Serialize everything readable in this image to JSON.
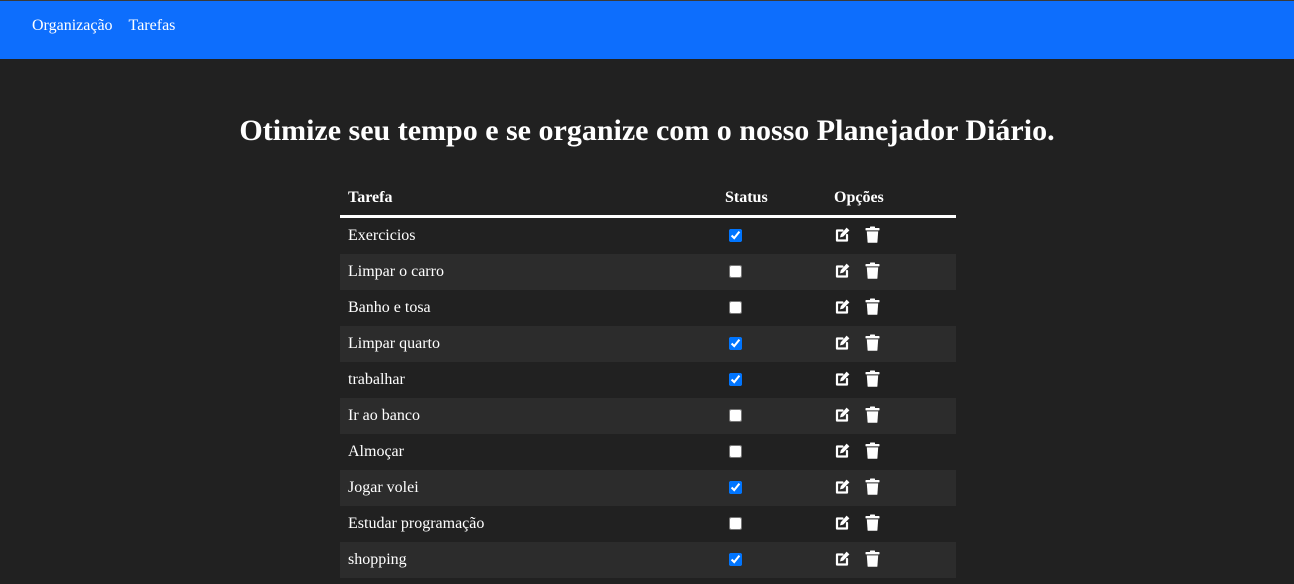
{
  "nav": {
    "items": [
      {
        "label": "Organização"
      },
      {
        "label": "Tarefas"
      }
    ]
  },
  "headline": "Otimize seu tempo e se organize com o nosso Planejador Diário.",
  "table": {
    "headers": {
      "task": "Tarefa",
      "status": "Status",
      "options": "Opções"
    },
    "rows": [
      {
        "task": "Exercicios",
        "done": true
      },
      {
        "task": "Limpar o carro",
        "done": false
      },
      {
        "task": "Banho e tosa",
        "done": false
      },
      {
        "task": "Limpar quarto",
        "done": true
      },
      {
        "task": "trabalhar",
        "done": true
      },
      {
        "task": "Ir ao banco",
        "done": false
      },
      {
        "task": "Almoçar",
        "done": false
      },
      {
        "task": "Jogar volei",
        "done": true
      },
      {
        "task": "Estudar programação",
        "done": false
      },
      {
        "task": "shopping",
        "done": true
      }
    ]
  },
  "icons": {
    "edit": "edit-icon",
    "delete": "trash-icon"
  },
  "colors": {
    "navbar": "#0d6efd",
    "background": "#212121",
    "row_stripe": "#2c2c2c",
    "text": "#ffffff"
  }
}
